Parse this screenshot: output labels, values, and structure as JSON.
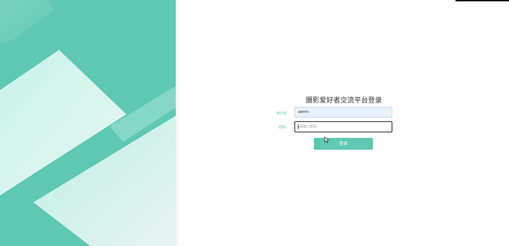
{
  "login": {
    "title": "摄影爱好者交流平台登录",
    "username_label": "用户名",
    "username_value": "admin",
    "password_label": "密码：",
    "password_placeholder": "请输入密码",
    "submit_label": "登录"
  },
  "colors": {
    "accent": "#5ec8b2",
    "input_fill": "#e8f0fd",
    "text": "#333333"
  },
  "icons": {
    "pointer": "mouse-pointer-icon"
  }
}
